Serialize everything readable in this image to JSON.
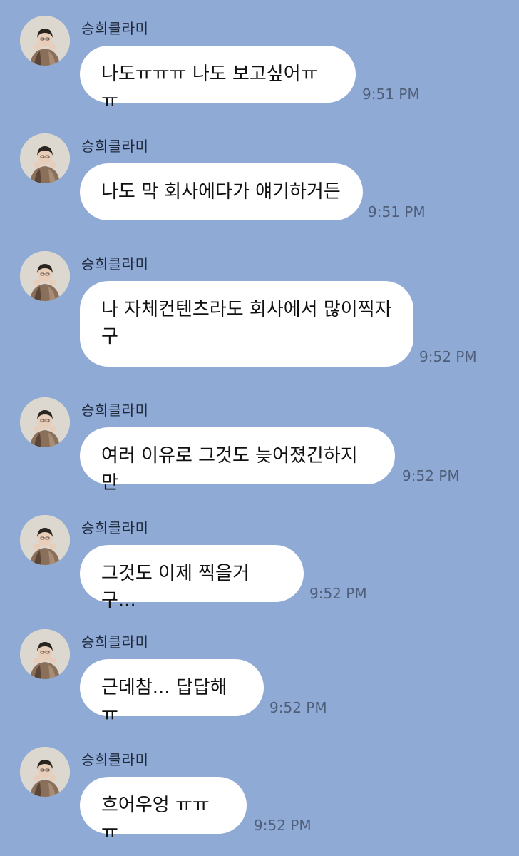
{
  "chat": {
    "messages": [
      {
        "sender": "승희클라미",
        "text": "나도ㅠㅠㅠ 나도 보고싶어ㅠㅠ",
        "time": "9:51 PM",
        "avatar_icon": "profile-photo-avatar"
      },
      {
        "sender": "승희클라미",
        "text": "나도 막 회사에다가 얘기하거든",
        "time": "9:51 PM",
        "avatar_icon": "profile-photo-avatar"
      },
      {
        "sender": "승희클라미",
        "text": "나 자체컨텐츠라도 회사에서 많이찍자\n구",
        "time": "9:52 PM",
        "avatar_icon": "profile-photo-avatar"
      },
      {
        "sender": "승희클라미",
        "text": "여러 이유로 그것도 늦어졌긴하지만",
        "time": "9:52 PM",
        "avatar_icon": "profile-photo-avatar"
      },
      {
        "sender": "승희클라미",
        "text": "그것도 이제 찍을거구...",
        "time": "9:52 PM",
        "avatar_icon": "profile-photo-avatar"
      },
      {
        "sender": "승희클라미",
        "text": "근데참... 답답해ㅠ",
        "time": "9:52 PM",
        "avatar_icon": "profile-photo-avatar"
      },
      {
        "sender": "승희클라미",
        "text": "흐어우엉 ㅠㅠㅠ",
        "time": "9:52 PM",
        "avatar_icon": "profile-photo-avatar"
      }
    ]
  },
  "colors": {
    "background": "#90aad6",
    "bubble": "#ffffff",
    "timestamp": "#4f5f7a",
    "sender": "#1f2a3d"
  }
}
